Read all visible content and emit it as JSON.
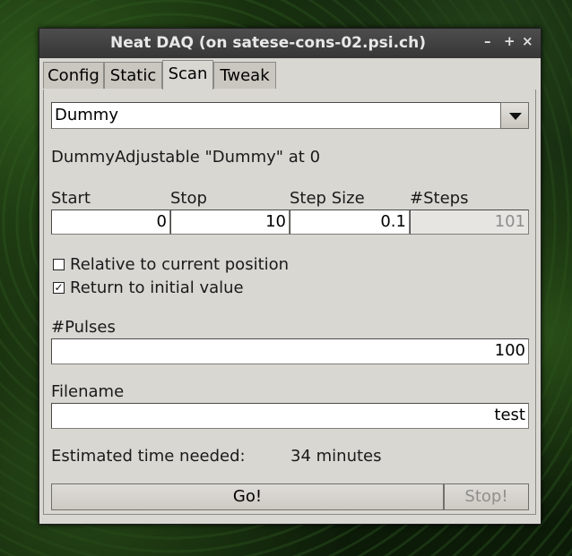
{
  "window": {
    "title": "Neat DAQ (on satese-cons-02.psi.ch)",
    "controls": {
      "minimize": "–",
      "maximize": "+",
      "close": "×"
    }
  },
  "tabs": [
    {
      "label": "Config"
    },
    {
      "label": "Static"
    },
    {
      "label": "Scan",
      "active": true
    },
    {
      "label": "Tweak"
    }
  ],
  "scan": {
    "adjustable_selected": "Dummy",
    "adjustable_desc": "DummyAdjustable \"Dummy\" at 0",
    "headers": {
      "start": "Start",
      "stop": "Stop",
      "step_size": "Step Size",
      "steps": "#Steps"
    },
    "values": {
      "start": "0",
      "stop": "10",
      "step_size": "0.1",
      "steps": "101"
    },
    "relative": {
      "label": "Relative to current position",
      "checked": false
    },
    "return_initial": {
      "label": "Return to initial value",
      "checked": true,
      "mark": "✓"
    },
    "pulses": {
      "label": "#Pulses",
      "value": "100"
    },
    "filename": {
      "label": "Filename",
      "value": "test"
    },
    "estimate": {
      "label": "Estimated time needed:",
      "value": "34 minutes"
    },
    "go_label": "Go!",
    "stop_label": "Stop!"
  }
}
